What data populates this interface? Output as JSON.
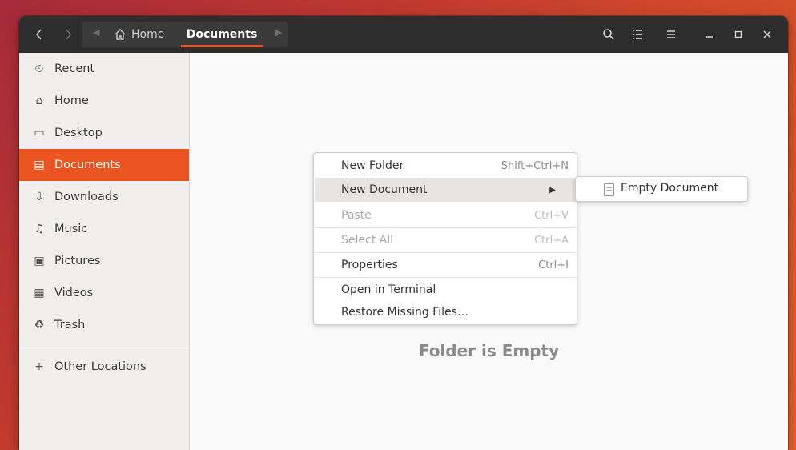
{
  "headerbar": {
    "back_icon": "chevron-left-icon",
    "forward_icon": "chevron-right-icon",
    "path": {
      "home_label": "Home",
      "current_label": "Documents"
    },
    "search_icon": "search-icon",
    "view_icon": "list-view-icon",
    "menu_icon": "hamburger-menu-icon",
    "minimize_icon": "minimize-icon",
    "maximize_icon": "maximize-icon",
    "close_icon": "close-icon"
  },
  "sidebar": {
    "items": [
      {
        "label": "Recent",
        "icon": "recent-icon"
      },
      {
        "label": "Home",
        "icon": "home-icon"
      },
      {
        "label": "Desktop",
        "icon": "desktop-icon"
      },
      {
        "label": "Documents",
        "icon": "documents-icon",
        "active": true
      },
      {
        "label": "Downloads",
        "icon": "downloads-icon"
      },
      {
        "label": "Music",
        "icon": "music-icon"
      },
      {
        "label": "Pictures",
        "icon": "pictures-icon"
      },
      {
        "label": "Videos",
        "icon": "videos-icon"
      },
      {
        "label": "Trash",
        "icon": "trash-icon"
      }
    ],
    "other_locations": {
      "label": "Other Locations",
      "icon": "plus-icon"
    }
  },
  "content": {
    "empty_message": "Folder is Empty"
  },
  "context_menu": {
    "items": [
      {
        "label": "New Folder",
        "accel": "Shift+Ctrl+N"
      },
      {
        "label": "New Document",
        "submenu": true
      },
      {
        "label": "Paste",
        "accel": "Ctrl+V",
        "disabled": true
      },
      {
        "label": "Select All",
        "accel": "Ctrl+A",
        "disabled": true
      },
      {
        "label": "Properties",
        "accel": "Ctrl+I"
      },
      {
        "label": "Open in Terminal"
      },
      {
        "label": "Restore Missing Files…"
      }
    ]
  },
  "submenu": {
    "items": [
      {
        "label": "Empty Document",
        "icon": "document-icon"
      }
    ]
  },
  "colors": {
    "accent": "#e95420",
    "headerbar": "#2d2d2d"
  }
}
